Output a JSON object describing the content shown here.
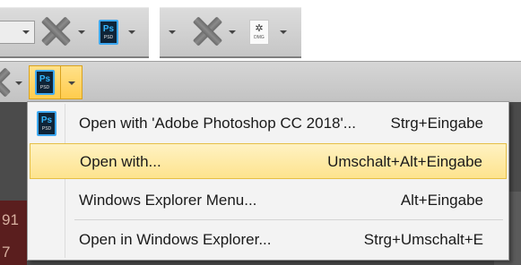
{
  "strip_left": {
    "icons": [
      "x-icon",
      "psd-file-icon"
    ],
    "psd_ext": "PSD",
    "psd_letters": "Ps"
  },
  "strip_right": {
    "icons": [
      "x-icon",
      "dmg-file-icon"
    ],
    "dmg_ext": "DMG"
  },
  "toolbar": {
    "psd_ext": "PSD",
    "psd_letters": "Ps"
  },
  "background": {
    "numbers": [
      "91",
      "7"
    ]
  },
  "menu": {
    "items": [
      {
        "label": "Open with 'Adobe Photoshop CC 2018'...",
        "shortcut": "Strg+Eingabe",
        "icon": "psd-file-icon",
        "icon_ext": "PSD",
        "icon_letters": "Ps"
      },
      {
        "label": "Open with...",
        "shortcut": "Umschalt+Alt+Eingabe",
        "highlighted": true
      },
      {
        "label": "Windows Explorer Menu...",
        "shortcut": "Alt+Eingabe"
      },
      {
        "label": "Open in Windows Explorer...",
        "shortcut": "Strg+Umschalt+E"
      }
    ]
  },
  "colors": {
    "highlight": "#fde38e",
    "highlight_border": "#e6bf45",
    "psd_blue": "#34b6ff",
    "psd_bg": "#0f2437"
  }
}
